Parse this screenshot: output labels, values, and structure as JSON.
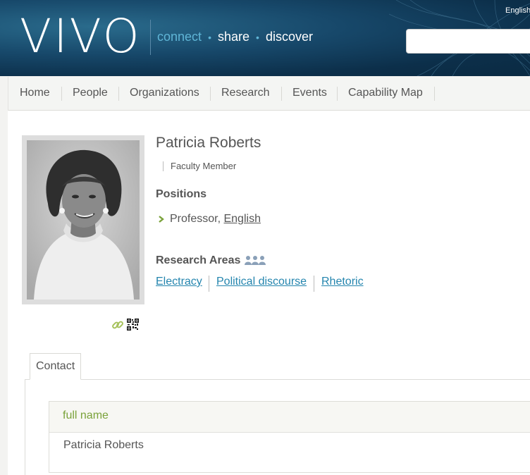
{
  "header": {
    "logo": "VIVO",
    "tagline": {
      "connect": "connect",
      "share": "share",
      "discover": "discover",
      "separator": "•"
    },
    "language": "English",
    "search": {
      "placeholder": ""
    }
  },
  "nav": {
    "items": [
      "Home",
      "People",
      "Organizations",
      "Research",
      "Events",
      "Capability Map"
    ]
  },
  "profile": {
    "name": "Patricia Roberts",
    "title": "Faculty Member",
    "positions_heading": "Positions",
    "position": {
      "role": "Professor,",
      "dept": "English"
    },
    "research_heading": "Research Areas",
    "research_areas": [
      "Electracy",
      "Political discourse",
      "Rhetoric"
    ]
  },
  "tabs": {
    "contact": "Contact"
  },
  "contact": {
    "label": "full name",
    "value": "Patricia Roberts"
  },
  "icons": {
    "link": "link-icon",
    "qr": "qr-code-icon",
    "arrow": "arrow-right-icon",
    "people": "people-group-icon"
  },
  "colors": {
    "header_dark": "#0c2f4a",
    "accent_blue": "#2485ae",
    "accent_green": "#7aa23a",
    "tagline_blue": "#5fb5d6"
  }
}
